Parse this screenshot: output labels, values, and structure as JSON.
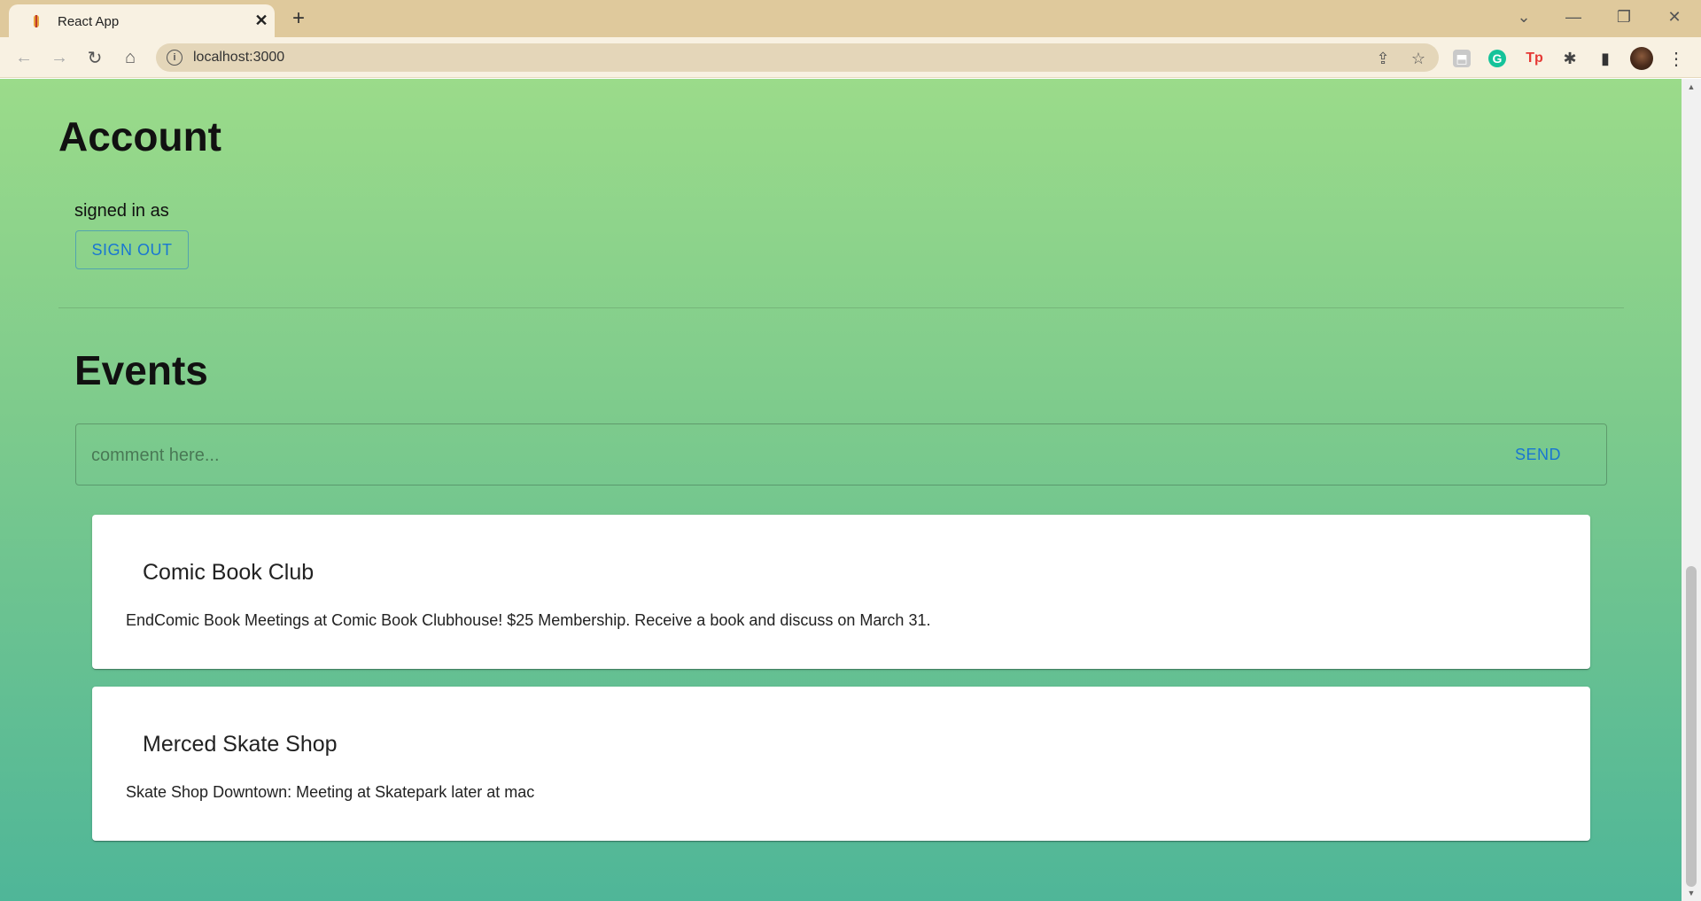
{
  "browser": {
    "tab_title": "React App",
    "new_tab_label": "+",
    "url": "localhost:3000",
    "window_controls": {
      "tab_search": "⌄",
      "minimize": "—",
      "restore": "❐",
      "close": "✕"
    },
    "nav": {
      "back": "←",
      "forward": "→",
      "reload": "↻",
      "home": "⌂"
    },
    "omnibox_icons": {
      "share": "⇪",
      "bookmark": "☆"
    },
    "extensions": {
      "ext1": "⬒",
      "grammarly": "G",
      "tp": "Tp",
      "puzzle": "✱",
      "side_panel": "▮",
      "menu": "⋮"
    }
  },
  "account": {
    "heading": "Account",
    "signed_in_text": "signed in as",
    "sign_out_label": "SIGN OUT"
  },
  "events": {
    "heading": "Events",
    "comment_placeholder": "comment here...",
    "send_label": "SEND",
    "items": [
      {
        "title": "Comic Book Club",
        "description": "EndComic Book Meetings at Comic Book Clubhouse! $25 Membership. Receive a book and discuss on March 31."
      },
      {
        "title": "Merced Skate Shop",
        "description": "Skate Shop Downtown: Meeting at Skatepark later at mac"
      }
    ]
  },
  "colors": {
    "accent": "#1976d2",
    "tabstrip": "#dfc99c",
    "toolbar": "#f8f1e2",
    "gradient_top": "#9bdb8a",
    "gradient_bottom": "#4fb698"
  }
}
